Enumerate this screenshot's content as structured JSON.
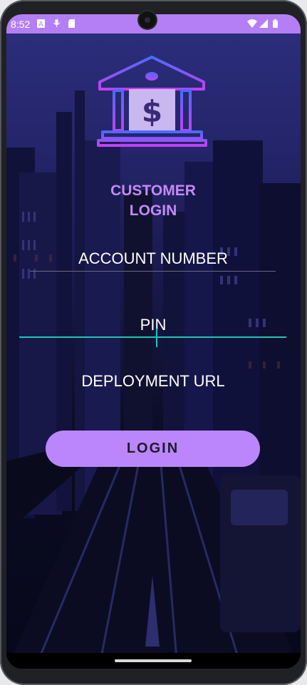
{
  "status_bar": {
    "time": "8:52",
    "icons_left": [
      "notification-a-icon",
      "mic-notification-icon",
      "sd-card-icon"
    ],
    "icons_right": [
      "wifi-icon",
      "cell-signal-icon",
      "battery-icon"
    ]
  },
  "app": {
    "title": "CUSTOMER\nLOGIN",
    "logo": "bank-dollar-icon",
    "account_label": "ACCOUNT NUMBER",
    "pin_label": "PIN",
    "url_label": "DEPLOYMENT URL",
    "login_label": "LOGIN"
  },
  "colors": {
    "status_bar": "#b47ff4",
    "accent": "#bb86fc",
    "focus": "#1ec6b4",
    "title": "#c48af4"
  }
}
